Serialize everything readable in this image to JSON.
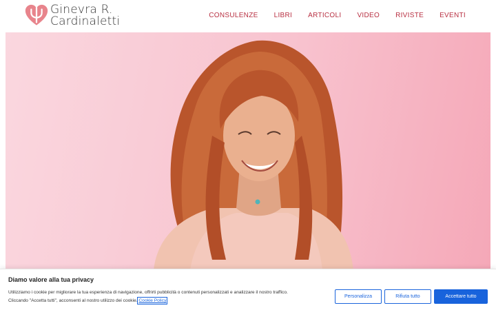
{
  "brand": {
    "line1": "Ginevra R.",
    "line2": "Cardinaletti",
    "logo_icon": "psi-heart-icon",
    "accent": "#b83042",
    "logo_color": "#e8848c"
  },
  "nav": {
    "items": [
      {
        "label": "CONSULENZE"
      },
      {
        "label": "LIBRI"
      },
      {
        "label": "ARTICOLI"
      },
      {
        "label": "VIDEO"
      },
      {
        "label": "RIVISTE"
      },
      {
        "label": "EVENTI"
      }
    ]
  },
  "hero": {
    "background": "#f8c3cf"
  },
  "cookie": {
    "title": "Diamo valore alla tua privacy",
    "text_line1": "Utilizziamo i cookie per migliorare la tua esperienza di navigazione, offrirti pubblicità o contenuti personalizzati e analizzare il nostro traffico.",
    "text_line2": "Cliccando \"Accetta tutti\", acconsenti al nostro utilizzo dei cookie.",
    "policy_link": "Cookie Policy",
    "buttons": {
      "customize": "Personalizza",
      "reject": "Rifiuta tutto",
      "accept": "Accettare tutto"
    },
    "button_color": "#1863dc"
  }
}
